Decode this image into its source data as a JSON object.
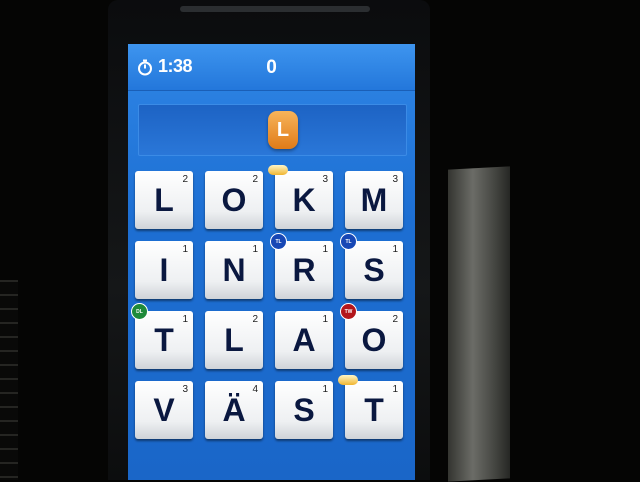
{
  "timer": "1:38",
  "score": "0",
  "current_word": [
    "L"
  ],
  "tiles": [
    {
      "letter": "L",
      "points": "2"
    },
    {
      "letter": "O",
      "points": "2"
    },
    {
      "letter": "K",
      "points": "3"
    },
    {
      "letter": "M",
      "points": "3"
    },
    {
      "letter": "I",
      "points": "1"
    },
    {
      "letter": "N",
      "points": "1"
    },
    {
      "letter": "R",
      "points": "1"
    },
    {
      "letter": "S",
      "points": "1"
    },
    {
      "letter": "T",
      "points": "1"
    },
    {
      "letter": "L",
      "points": "2"
    },
    {
      "letter": "A",
      "points": "1"
    },
    {
      "letter": "O",
      "points": "2"
    },
    {
      "letter": "V",
      "points": "3"
    },
    {
      "letter": "Ä",
      "points": "4"
    },
    {
      "letter": "S",
      "points": "1"
    },
    {
      "letter": "T",
      "points": "1"
    }
  ],
  "badges": {
    "dl": "DL",
    "tl": "TL",
    "tw": "TW"
  },
  "colors": {
    "screen": "#1d6fd3",
    "tile": "#f2f3f5",
    "letter": "#0a1840",
    "word_tile": "#e8882a",
    "dl": "#1f8a3a",
    "tl": "#1747b5",
    "tw": "#b2161c"
  }
}
